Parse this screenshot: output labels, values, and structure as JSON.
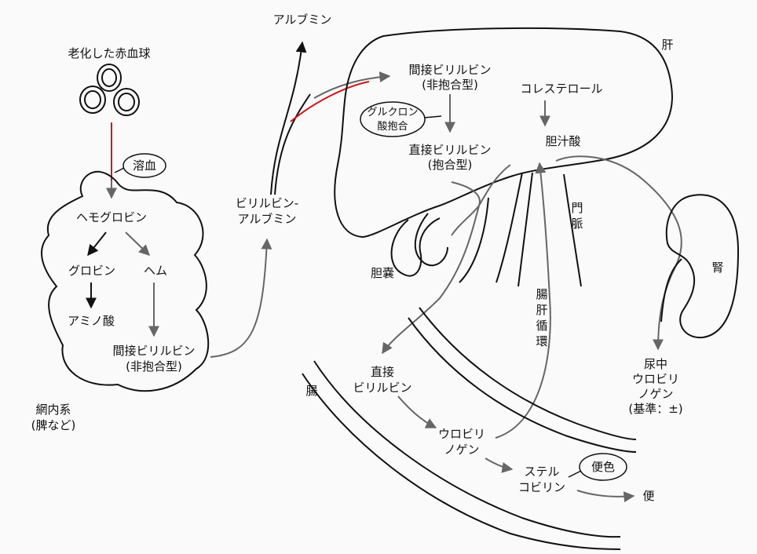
{
  "colors": {
    "ink": "#111111",
    "flow": "#666666",
    "hemolysis": "#d0161b",
    "background": "#fafafa"
  },
  "labels": {
    "aged_rbc": "老化した赤血球",
    "hemolysis": "溶血",
    "hemoglobin": "ヘモグロビン",
    "globin": "グロビン",
    "heme": "ヘム",
    "amino_acid": "アミノ酸",
    "indirect_bilirubin_rs": [
      "間接ビリルビン",
      "(非抱合型)"
    ],
    "res": [
      "網内系",
      "(脾など)"
    ],
    "bilirubin_albumin": [
      "ビリルビン-",
      "アルブミン"
    ],
    "albumin": "アルブミン",
    "liver": "肝",
    "indirect_bilirubin_liver": [
      "間接ビリルビン",
      "(非抱合型)"
    ],
    "glucuronidation": [
      "グルクロン",
      "酸抱合"
    ],
    "direct_bilirubin_liver": [
      "直接ビリルビン",
      "(抱合型)"
    ],
    "cholesterol": "コレステロール",
    "bile_acid": "胆汁酸",
    "portal_vein": [
      "門",
      "脈"
    ],
    "gallbladder": "胆嚢",
    "enterohepatic": [
      "腸",
      "肝",
      "循",
      "環"
    ],
    "kidney": "腎",
    "urine_urobilinogen": [
      "尿中",
      "ウロビリ",
      "ノゲン",
      "(基準：±)"
    ],
    "intestine": "腸",
    "direct_bilirubin_gut": [
      "直接",
      "ビリルビン"
    ],
    "urobilinogen": [
      "ウロビリ",
      "ノゲン"
    ],
    "stercobilin": [
      "ステル",
      "コビリン"
    ],
    "stool_color": "便色",
    "stool": "便"
  }
}
